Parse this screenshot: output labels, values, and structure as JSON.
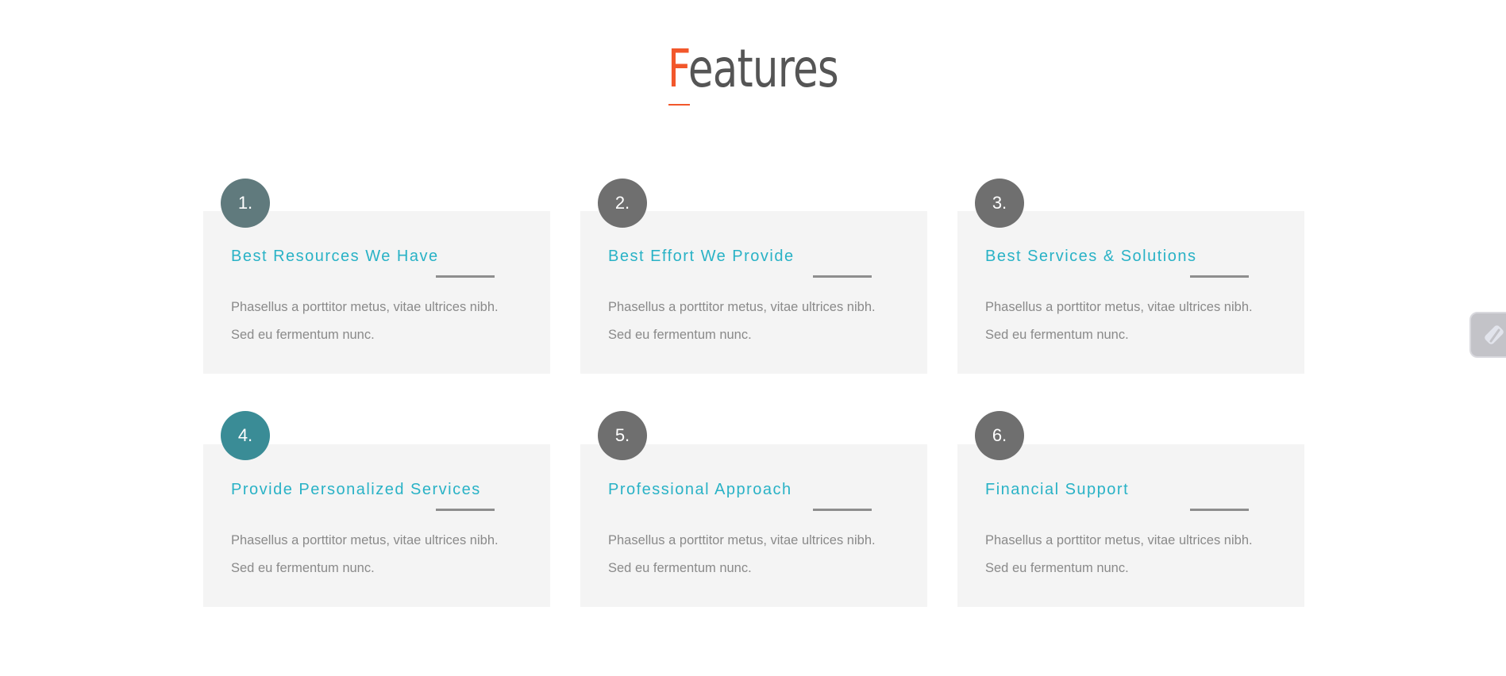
{
  "section": {
    "title_first": "F",
    "title_rest": "eatures"
  },
  "cards": [
    {
      "number": "1.",
      "title": "Best Resources We Have",
      "text": "Phasellus a porttitor metus, vitae ultrices nibh. Sed eu fermentum nunc.",
      "badge_color": "#607a7d"
    },
    {
      "number": "2.",
      "title": "Best Effort We Provide",
      "text": "Phasellus a porttitor metus, vitae ultrices nibh. Sed eu fermentum nunc.",
      "badge_color": "#6f6f6f"
    },
    {
      "number": "3.",
      "title": "Best Services & Solutions",
      "text": "Phasellus a porttitor metus, vitae ultrices nibh. Sed eu fermentum nunc.",
      "badge_color": "#6f6f6f"
    },
    {
      "number": "4.",
      "title": "Provide Personalized Services",
      "text": "Phasellus a porttitor metus, vitae ultrices nibh. Sed eu fermentum nunc.",
      "badge_color": "#3a8c96"
    },
    {
      "number": "5.",
      "title": "Professional Approach",
      "text": "Phasellus a porttitor metus, vitae ultrices nibh. Sed eu fermentum nunc.",
      "badge_color": "#6f6f6f"
    },
    {
      "number": "6.",
      "title": "Financial Support",
      "text": "Phasellus a porttitor metus, vitae ultrices nibh. Sed eu fermentum nunc.",
      "badge_color": "#6f6f6f"
    }
  ],
  "side_widget": {
    "icon": "lightning-icon"
  },
  "colors": {
    "accent": "#f2572b",
    "card_title": "#29b2c6",
    "card_background": "#f4f4f4"
  }
}
